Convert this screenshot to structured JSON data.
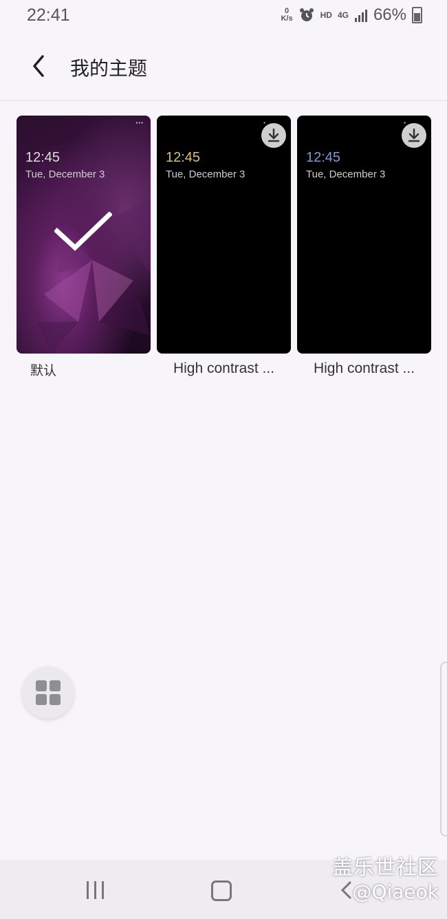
{
  "status_bar": {
    "time": "22:41",
    "net_speed_value": "0",
    "net_speed_unit": "K/s",
    "hd": "HD",
    "network": "4G",
    "battery": "66%"
  },
  "header": {
    "title": "我的主题"
  },
  "themes": [
    {
      "label": "默认",
      "time": "12:45",
      "date": "Tue, December 3",
      "time_color": "#dddddd",
      "selected": true,
      "downloadable": false
    },
    {
      "label": "High contrast ...",
      "time": "12:45",
      "date": "Tue, December 3",
      "time_color": "#d8c07a",
      "selected": false,
      "downloadable": true
    },
    {
      "label": "High contrast ...",
      "time": "12:45",
      "date": "Tue, December 3",
      "time_color": "#7f9ad8",
      "selected": false,
      "downloadable": true
    }
  ],
  "icons": {
    "back": "back-arrow-icon",
    "download": "download-icon",
    "fab": "grid-icon",
    "check": "checkmark-icon"
  },
  "watermark": {
    "line1": "盖乐世社区",
    "line2": "@Qiaeok"
  },
  "colors": {
    "background": "#f7f5fa",
    "nav_bar": "#eeecf1"
  }
}
